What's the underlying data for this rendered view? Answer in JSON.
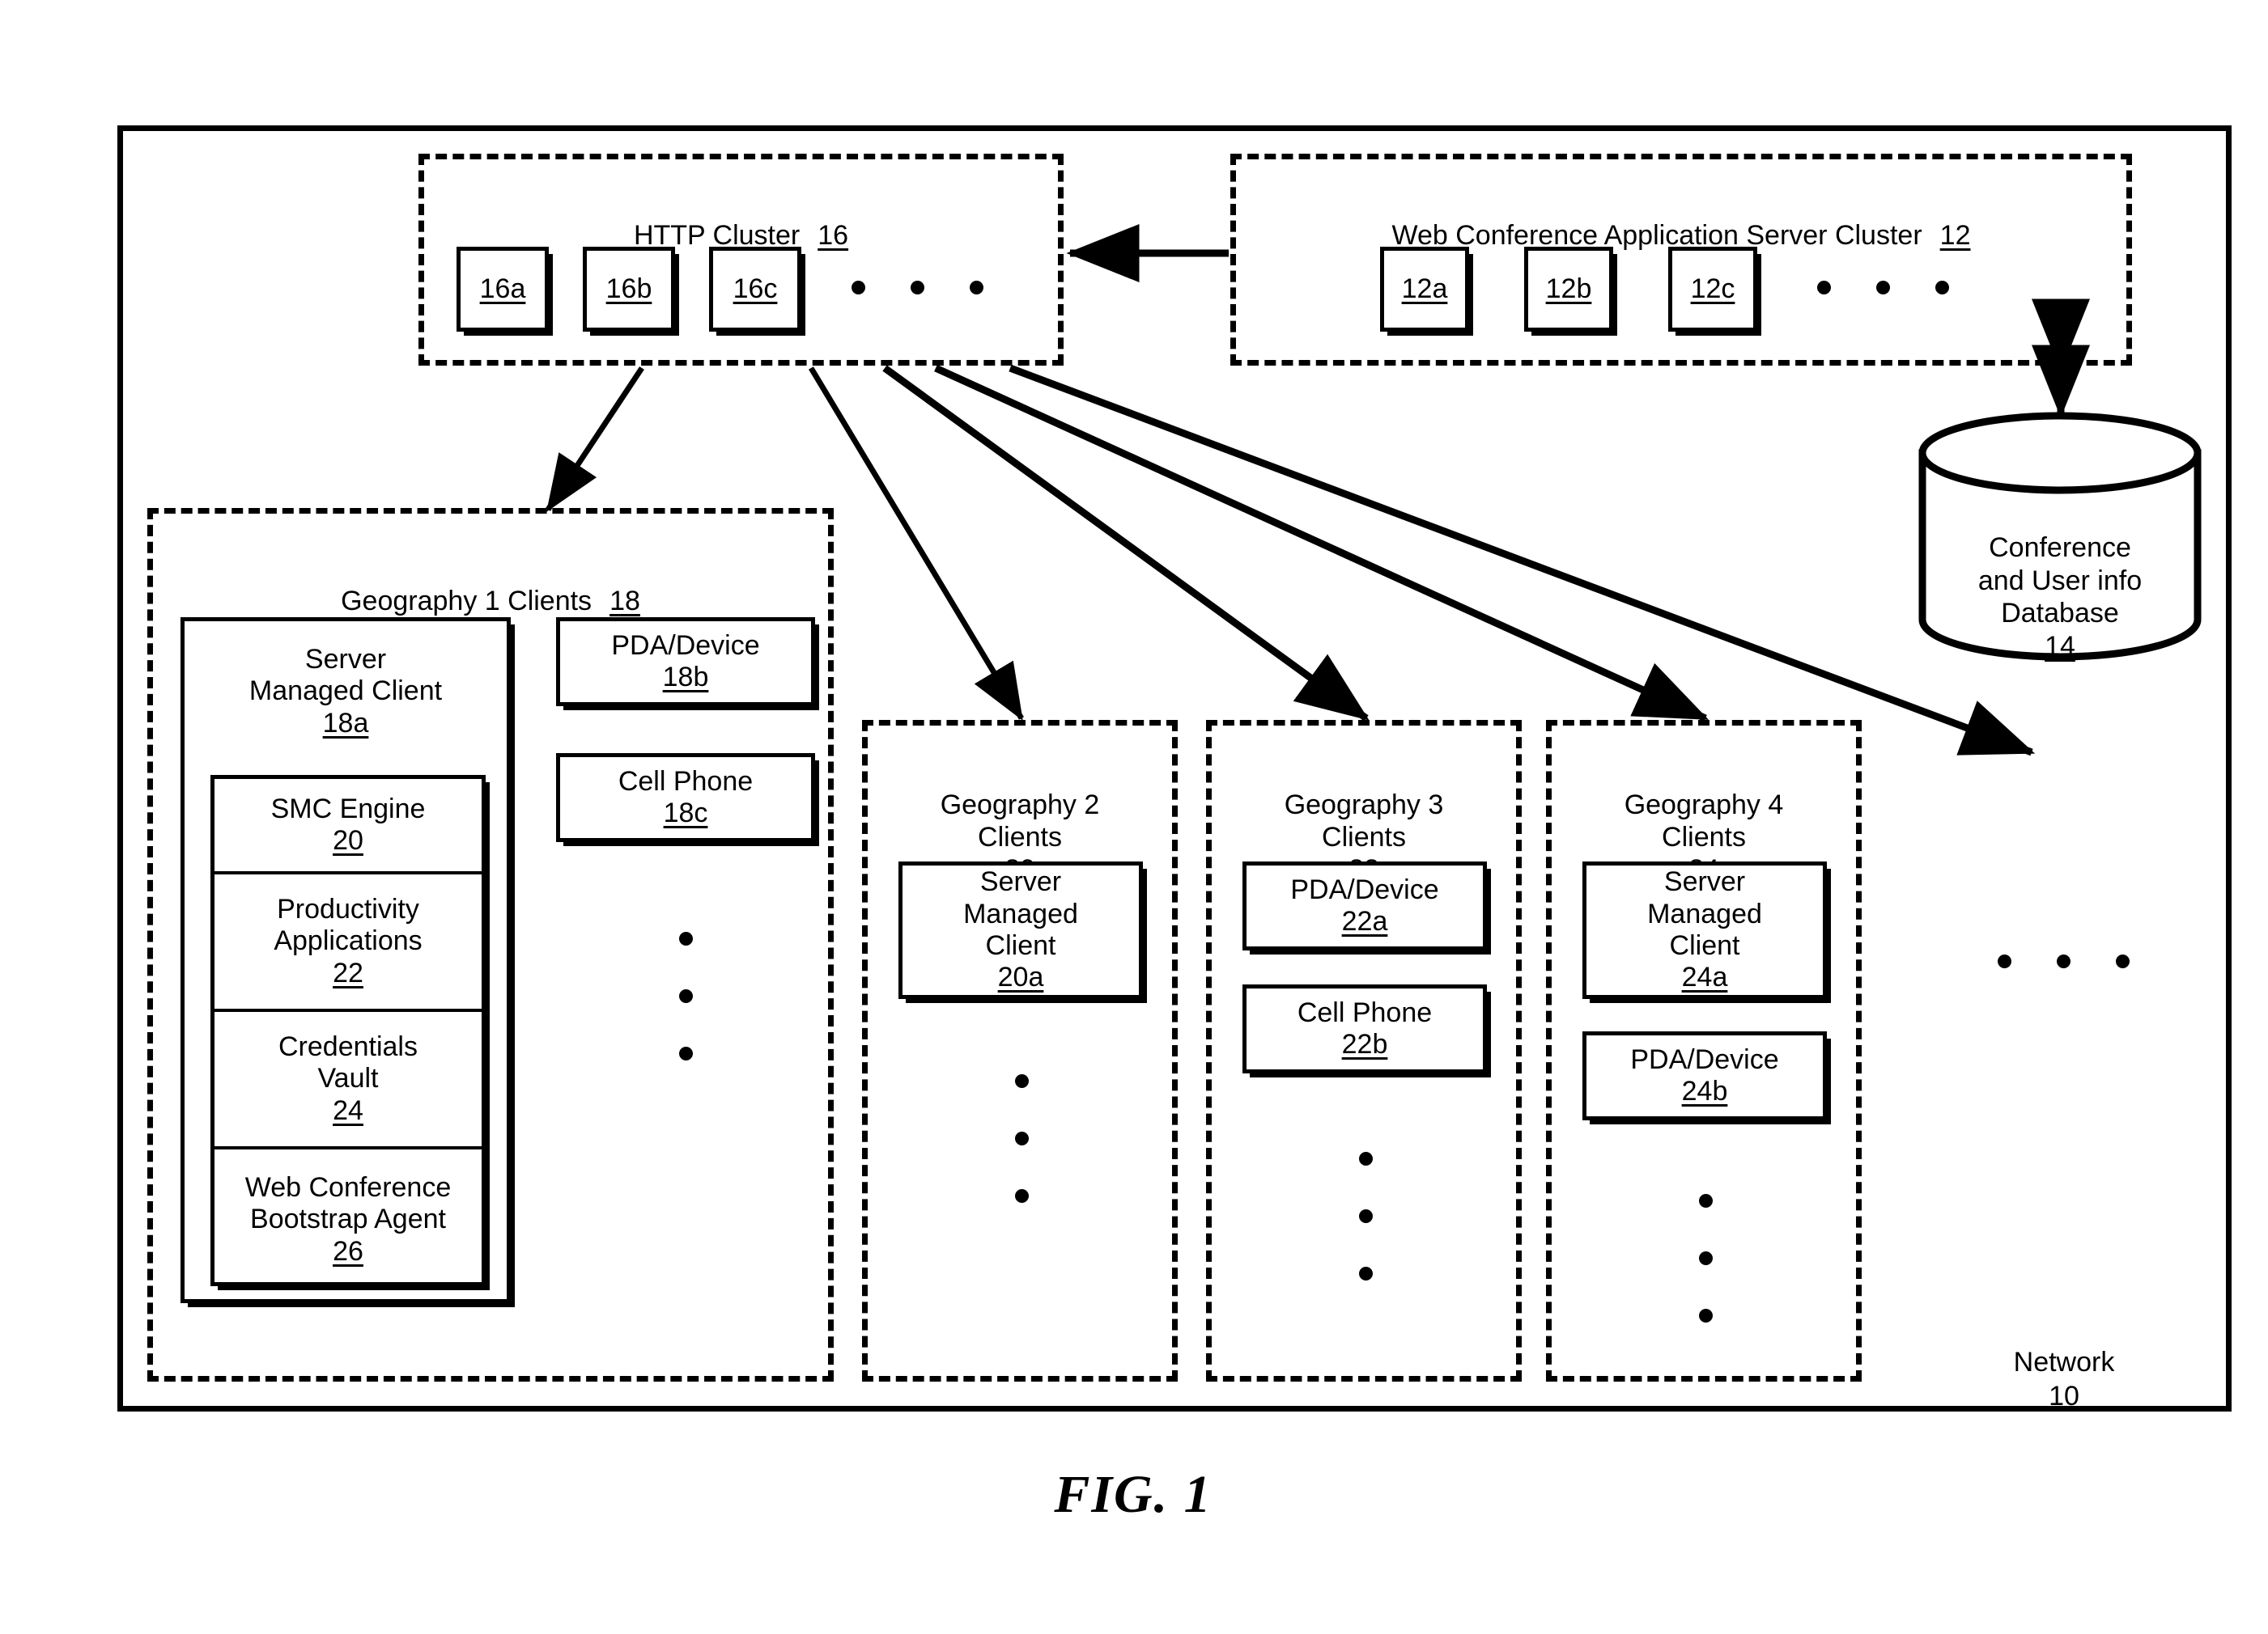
{
  "figure": {
    "caption": "FIG. 1",
    "network_label": "Network",
    "network_ref": "10"
  },
  "http_cluster": {
    "title": "HTTP Cluster",
    "ref": "16",
    "nodes": [
      {
        "ref": "16a"
      },
      {
        "ref": "16b"
      },
      {
        "ref": "16c"
      }
    ],
    "ellipsis": "• • •"
  },
  "app_server_cluster": {
    "title": "Web Conference Application Server Cluster",
    "ref": "12",
    "nodes": [
      {
        "ref": "12a"
      },
      {
        "ref": "12b"
      },
      {
        "ref": "12c"
      }
    ],
    "ellipsis": "• • •"
  },
  "database": {
    "label": "Conference\nand User info\nDatabase",
    "ref": "14"
  },
  "geography1": {
    "title": "Geography 1 Clients",
    "ref": "18",
    "server_managed_client": {
      "label": "Server\nManaged Client",
      "ref": "18a",
      "modules": [
        {
          "label": "SMC Engine",
          "ref": "20"
        },
        {
          "label": "Productivity\nApplications",
          "ref": "22"
        },
        {
          "label": "Credentials\nVault",
          "ref": "24"
        },
        {
          "label": "Web Conference\nBootstrap Agent",
          "ref": "26"
        }
      ]
    },
    "devices": [
      {
        "label": "PDA/Device",
        "ref": "18b"
      },
      {
        "label": "Cell Phone",
        "ref": "18c"
      }
    ]
  },
  "geography2": {
    "title": "Geography 2\nClients",
    "ref": "20",
    "devices": [
      {
        "label": "Server\nManaged\nClient",
        "ref": "20a"
      }
    ]
  },
  "geography3": {
    "title": "Geography 3\nClients",
    "ref": "22",
    "devices": [
      {
        "label": "PDA/Device",
        "ref": "22a"
      },
      {
        "label": "Cell Phone",
        "ref": "22b"
      }
    ]
  },
  "geography4": {
    "title": "Geography 4\nClients",
    "ref": "24",
    "devices": [
      {
        "label": "Server\nManaged\nClient",
        "ref": "24a"
      },
      {
        "label": "PDA/Device",
        "ref": "24b"
      }
    ]
  },
  "colors": {
    "stroke": "#000000",
    "background": "#ffffff"
  }
}
